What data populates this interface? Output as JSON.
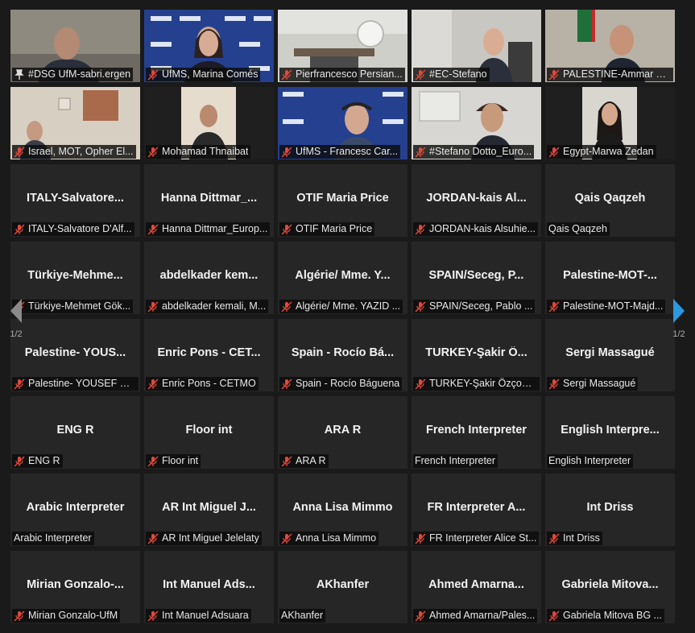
{
  "colors": {
    "tile_bg": "#262626",
    "active_border": "#e6e045",
    "muted_red": "#e0483c",
    "nav_active": "#2a9ae0",
    "nav_inactive": "#8a8a8a"
  },
  "pagination": {
    "left_page": "1/2",
    "right_page": "1/2"
  },
  "video_tiles": [
    {
      "name": "#DSG UfM-sabri.ergen",
      "active": true,
      "icon": "pin-icon"
    },
    {
      "name": "UfMS, Marina Comés",
      "icon": "mic-muted-icon"
    },
    {
      "name": "Pierfrancesco Persian...",
      "icon": "mic-muted-icon"
    },
    {
      "name": "#EC-Stefano",
      "icon": "mic-muted-icon"
    },
    {
      "name": "PALESTINE-Ammar Ya...",
      "icon": "mic-muted-icon"
    },
    {
      "name": "Israel, MOT, Opher El...",
      "icon": "mic-muted-icon"
    },
    {
      "name": "Mohamad Thnaibat",
      "icon": "mic-muted-icon"
    },
    {
      "name": "UfMS - Francesc Car...",
      "icon": "mic-muted-icon"
    },
    {
      "name": "#Stefano Dotto_Euro...",
      "icon": "mic-muted-icon"
    },
    {
      "name": "Egypt-Marwa Zedan",
      "icon": "mic-muted-icon"
    }
  ],
  "name_tiles": [
    {
      "big": "ITALY-Salvatore...",
      "label": "ITALY-Salvatore D'Alf...",
      "muted": true
    },
    {
      "big": "Hanna  Dittmar_...",
      "label": "Hanna Dittmar_Europ...",
      "muted": true
    },
    {
      "big": "OTIF Maria Price",
      "label": "OTIF Maria Price",
      "muted": true
    },
    {
      "big": "JORDAN-kais  Al...",
      "label": "JORDAN-kais Alsuhie...",
      "muted": true
    },
    {
      "big": "Qais Qaqzeh",
      "label": "Qais Qaqzeh",
      "muted": false
    },
    {
      "big": "Türkiye-Mehme...",
      "label": "Türkiye-Mehmet Gök...",
      "muted": true
    },
    {
      "big": "abdelkader  kem...",
      "label": "abdelkader kemali, M...",
      "muted": true
    },
    {
      "big": "Algérie/  Mme.  Y...",
      "label": "Algérie/ Mme. YAZID ...",
      "muted": true
    },
    {
      "big": "SPAIN/Seceg,  P...",
      "label": "SPAIN/Seceg, Pablo ...",
      "muted": true
    },
    {
      "big": "Palestine-MOT-...",
      "label": "Palestine-MOT-Majd...",
      "muted": true
    },
    {
      "big": "Palestine-  YOUS...",
      "label": "Palestine- YOUSEF DA...",
      "muted": true
    },
    {
      "big": "Enric Pons - CET...",
      "label": "Enric Pons - CETMO",
      "muted": true
    },
    {
      "big": "Spain  -  Rocío  Bá...",
      "label": "Spain - Rocío Báguena",
      "muted": true
    },
    {
      "big": "TURKEY-Şakir  Ö...",
      "label": "TURKEY-Şakir Özçoban",
      "muted": true
    },
    {
      "big": "Sergi Massagué",
      "label": "Sergi Massagué",
      "muted": true
    },
    {
      "big": "ENG R",
      "label": "ENG R",
      "muted": true
    },
    {
      "big": "Floor int",
      "label": "Floor int",
      "muted": true
    },
    {
      "big": "ARA R",
      "label": "ARA R",
      "muted": true
    },
    {
      "big": "French Interpreter",
      "label": "French Interpreter",
      "muted": false
    },
    {
      "big": "English  Interpre...",
      "label": "English Interpreter",
      "muted": false
    },
    {
      "big": "Arabic Interpreter",
      "label": "Arabic Interpreter",
      "muted": false
    },
    {
      "big": "AR Int Miguel J...",
      "label": "AR Int Miguel Jelelaty",
      "muted": true
    },
    {
      "big": "Anna Lisa Mimmo",
      "label": "Anna Lisa Mimmo",
      "muted": true
    },
    {
      "big": "FR Interpreter A...",
      "label": "FR Interpreter Alice St...",
      "muted": true
    },
    {
      "big": "Int Driss",
      "label": "Int Driss",
      "muted": true
    },
    {
      "big": "Mirian  Gonzalo-...",
      "label": "Mirian Gonzalo-UfM",
      "muted": true
    },
    {
      "big": "Int Manuel Ads...",
      "label": "Int Manuel Adsuara",
      "muted": true
    },
    {
      "big": "AKhanfer",
      "label": "AKhanfer",
      "muted": false
    },
    {
      "big": "Ahmed  Amarna...",
      "label": "Ahmed Amarna/Pales...",
      "muted": true
    },
    {
      "big": "Gabriela  Mitova...",
      "label": "Gabriela Mitova BG ...",
      "muted": true
    }
  ]
}
